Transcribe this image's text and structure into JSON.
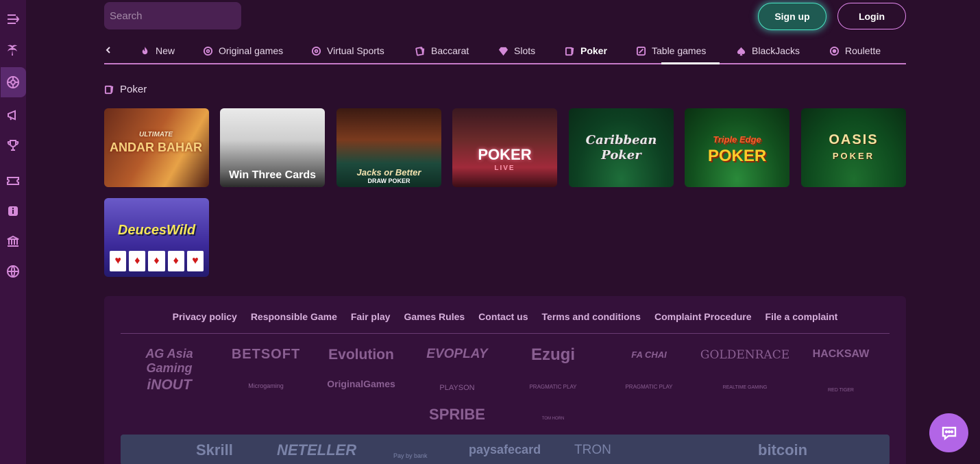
{
  "search": {
    "placeholder": "Search"
  },
  "header": {
    "signup_label": "Sign up",
    "login_label": "Login"
  },
  "tabs": [
    {
      "label": "New",
      "icon": "flame-icon"
    },
    {
      "label": "Original games",
      "icon": "chip-icon"
    },
    {
      "label": "Virtual Sports",
      "icon": "chip-icon"
    },
    {
      "label": "Baccarat",
      "icon": "cards-icon"
    },
    {
      "label": "Slots",
      "icon": "diamond-icon"
    },
    {
      "label": "Poker",
      "icon": "cards-icon",
      "active": true
    },
    {
      "label": "Table games",
      "icon": "table-icon"
    },
    {
      "label": "BlackJacks",
      "icon": "spade-icon"
    },
    {
      "label": "Roulette",
      "icon": "roulette-icon"
    }
  ],
  "section": {
    "title": "Poker"
  },
  "games": [
    {
      "title": "ANDAR BAHAR",
      "subtitle": "ULTIMATE"
    },
    {
      "title": "Win Three Cards"
    },
    {
      "title": "Jacks or Better",
      "subtitle": "DRAW POKER"
    },
    {
      "title": "POKER",
      "subtitle": "LIVE"
    },
    {
      "title": "Caribbean Poker"
    },
    {
      "title": "POKER",
      "subtitle": "Triple Edge"
    },
    {
      "title": "OASIS",
      "subtitle": "POKER"
    },
    {
      "title": "DeucesWild"
    }
  ],
  "footer": {
    "links": [
      "Privacy policy",
      "Responsible Game",
      "Fair play",
      "Games Rules",
      "Contact us",
      "Terms and conditions",
      "Complaint Procedure",
      "File a complaint"
    ],
    "providers": [
      "AG Asia Gaming",
      "BETSOFT",
      "Evolution",
      "EVOPLAY",
      "Ezugi",
      "FA CHAI",
      "GOLDENRACE",
      "HACKSAW",
      "iNOUT",
      "Microgaming",
      "OriginalGames",
      "PLAYSON",
      "PRAGMATIC PLAY",
      "PRAGMATIC PLAY",
      "REALTIME GAMING",
      "RED TIGER",
      "SPRIBE",
      "TOM HORN"
    ],
    "payments": [
      "Skrill",
      "NETELLER",
      "Pay by bank",
      "paysafecard",
      "TRON",
      "bitcoin"
    ]
  }
}
